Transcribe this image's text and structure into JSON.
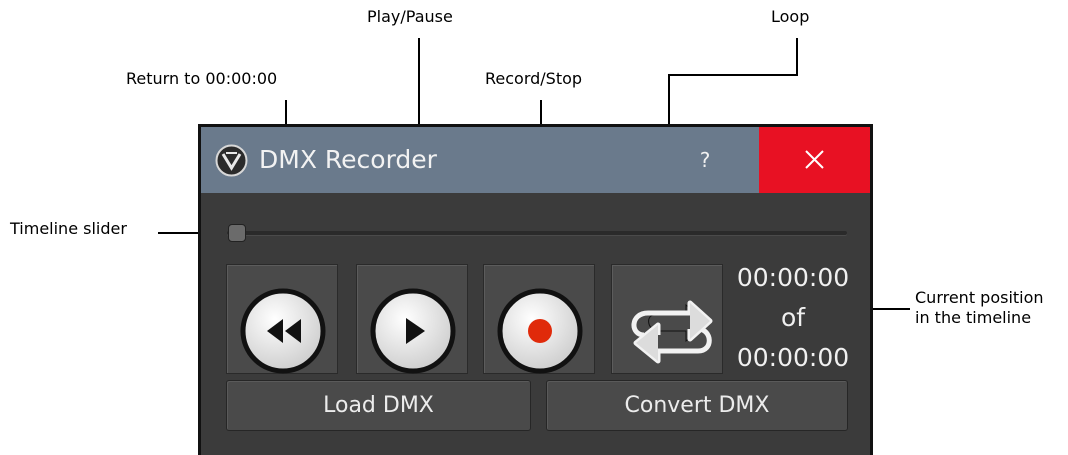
{
  "callouts": {
    "play_pause": "Play/Pause",
    "loop": "Loop",
    "return": "Return to 00:00:00",
    "record_stop": "Record/Stop",
    "timeline_slider": "Timeline slider",
    "position_line1": "Current position",
    "position_line2": "in the timeline"
  },
  "window": {
    "title": "DMX Recorder",
    "help_label": "?",
    "close_icon": "close-icon",
    "titlebar_color": "#6a7a8c",
    "close_color": "#e81123"
  },
  "transport": {
    "rewind_icon": "rewind-icon",
    "play_icon": "play-icon",
    "record_icon": "record-icon",
    "loop_icon": "loop-icon",
    "record_color": "#e02a0a"
  },
  "timeline": {
    "slider_position": 0,
    "current_time": "00:00:00",
    "of_label": "of",
    "total_time": "00:00:00"
  },
  "actions": {
    "load_label": "Load DMX",
    "convert_label": "Convert DMX"
  }
}
